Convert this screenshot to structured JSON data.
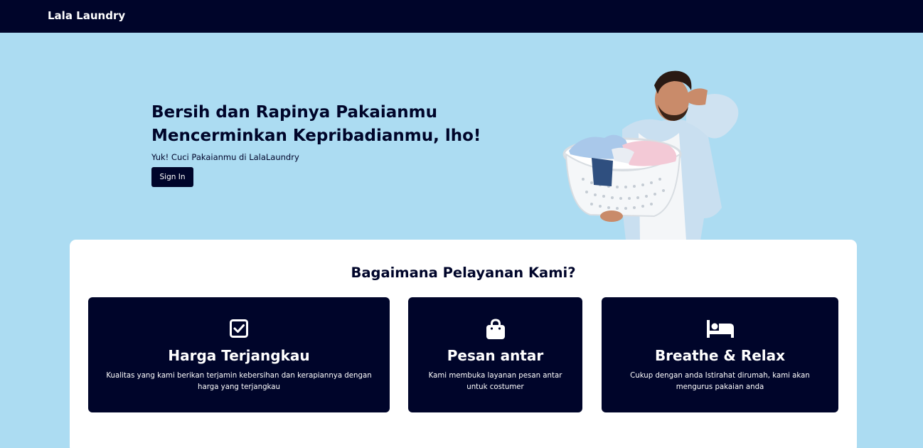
{
  "navbar": {
    "brand": "Lala Laundry"
  },
  "hero": {
    "title_line1": "Bersih dan Rapinya Pakaianmu",
    "title_line2": "Mencerminkan Kepribadianmu, lho!",
    "subtitle": "Yuk! Cuci Pakaianmu di LalaLaundry",
    "signin_label": "Sign In",
    "image_icon": "man-with-laundry-basket"
  },
  "services": {
    "title": "Bagaimana Pelayanan Kami?",
    "cards": [
      {
        "icon": "check-square-icon",
        "title": "Harga Terjangkau",
        "description": "Kualitas yang kami berikan terjamin kebersihan dan kerapiannya dengan harga yang terjangkau"
      },
      {
        "icon": "shopping-bag-icon",
        "title": "Pesan antar",
        "description": "Kami membuka layanan pesan antar untuk costumer"
      },
      {
        "icon": "bed-icon",
        "title": "Breathe & Relax",
        "description": "Cukup dengan anda Istirahat dirumah, kami akan mengurus pakaian anda"
      }
    ]
  },
  "colors": {
    "navy": "#00052a",
    "background": "#acdcf2",
    "white": "#ffffff"
  }
}
